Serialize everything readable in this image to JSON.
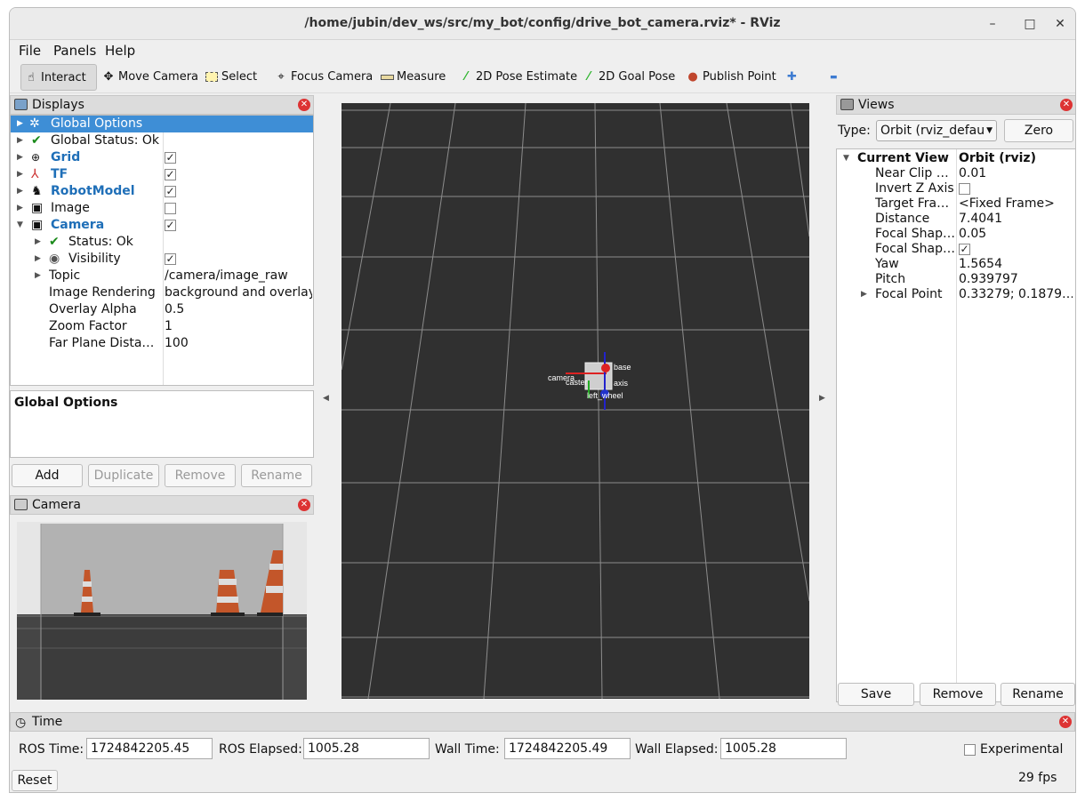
{
  "window": {
    "title": "/home/jubin/dev_ws/src/my_bot/config/drive_bot_camera.rviz* - RViz",
    "min": "–",
    "max": "□",
    "close": "✕"
  },
  "menu": [
    "File",
    "Panels",
    "Help"
  ],
  "toolbar": {
    "interact": "Interact",
    "move_camera": "Move Camera",
    "select": "Select",
    "focus_camera": "Focus Camera",
    "measure": "Measure",
    "pose_estimate": "2D Pose Estimate",
    "goal_pose": "2D Goal Pose",
    "publish_point": "Publish Point",
    "plus": "✚",
    "minus": "▬"
  },
  "displays": {
    "title": "Displays",
    "items": [
      {
        "label": "Global Options"
      },
      {
        "label": "Global Status: Ok"
      },
      {
        "label": "Grid",
        "checked": true
      },
      {
        "label": "TF",
        "checked": true
      },
      {
        "label": "RobotModel",
        "checked": true
      },
      {
        "label": "Image",
        "checked": false
      },
      {
        "label": "Camera",
        "checked": true
      },
      {
        "label": "Status: Ok"
      },
      {
        "label": "Visibility",
        "checked": true
      },
      {
        "label": "Topic",
        "value": "/camera/image_raw"
      },
      {
        "label": "Image Rendering",
        "value": "background and overlay"
      },
      {
        "label": "Overlay Alpha",
        "value": "0.5"
      },
      {
        "label": "Zoom Factor",
        "value": "1"
      },
      {
        "label": "Far Plane Dista…",
        "value": "100"
      }
    ],
    "description": "Global Options",
    "buttons": {
      "add": "Add",
      "duplicate": "Duplicate",
      "remove": "Remove",
      "rename": "Rename"
    }
  },
  "camera_panel": {
    "title": "Camera"
  },
  "scene_labels": {
    "camera": "camera",
    "caster": "caster",
    "left_wheel": "left_wheel",
    "base": "base",
    "axis": "axis"
  },
  "views": {
    "title": "Views",
    "type_label": "Type:",
    "type_value": "Orbit (rviz_defau",
    "zero": "Zero",
    "header": {
      "name": "Current View",
      "value": "Orbit (rviz)"
    },
    "props": [
      {
        "name": "Near Clip …",
        "value": "0.01"
      },
      {
        "name": "Invert Z Axis",
        "checkbox": true,
        "checked": false
      },
      {
        "name": "Target Fra…",
        "value": "<Fixed Frame>"
      },
      {
        "name": "Distance",
        "value": "7.4041"
      },
      {
        "name": "Focal Shap…",
        "value": "0.05"
      },
      {
        "name": "Focal Shap…",
        "checkbox": true,
        "checked": true
      },
      {
        "name": "Yaw",
        "value": "1.5654"
      },
      {
        "name": "Pitch",
        "value": "0.939797"
      },
      {
        "name": "Focal Point",
        "value": "0.33279; 0.1879…"
      }
    ],
    "buttons": {
      "save": "Save",
      "remove": "Remove",
      "rename": "Rename"
    }
  },
  "time": {
    "title": "Time",
    "ros_time_label": "ROS Time:",
    "ros_time": "1724842205.45",
    "ros_elapsed_label": "ROS Elapsed:",
    "ros_elapsed": "1005.28",
    "wall_time_label": "Wall Time:",
    "wall_time": "1724842205.49",
    "wall_elapsed_label": "Wall Elapsed:",
    "wall_elapsed": "1005.28",
    "experimental": "Experimental",
    "reset": "Reset",
    "fps": "29 fps"
  }
}
